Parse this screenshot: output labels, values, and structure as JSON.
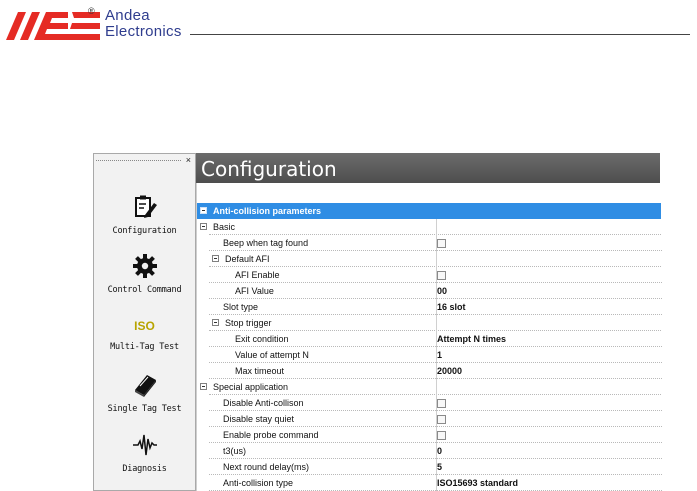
{
  "brand": {
    "line1": "Andea",
    "line2": "Electronics",
    "registered": "®",
    "colors": {
      "red": "#e52b24",
      "blue": "#2f3d8e"
    }
  },
  "sidebar": {
    "close_glyph": "×",
    "items": [
      {
        "label": "Configuration",
        "icon": "clipboard-pencil-icon"
      },
      {
        "label": "Control Command",
        "icon": "gear-icon"
      },
      {
        "label": "Multi-Tag Test",
        "icon": "iso-text-icon",
        "icon_text": "ISO"
      },
      {
        "label": "Single Tag Test",
        "icon": "book-icon"
      },
      {
        "label": "Diagnosis",
        "icon": "waveform-icon"
      }
    ]
  },
  "main": {
    "title": "Configuration",
    "grid": {
      "header": "Anti-collision parameters",
      "rows": [
        {
          "kind": "cat",
          "label": "Basic",
          "level": 0
        },
        {
          "kind": "leaf",
          "label": "Beep when tag found",
          "level": 1,
          "type": "checkbox",
          "checked": false
        },
        {
          "kind": "cat",
          "label": "Default AFI",
          "level": 1
        },
        {
          "kind": "leaf",
          "label": "AFI Enable",
          "level": 2,
          "type": "checkbox",
          "checked": false
        },
        {
          "kind": "leaf",
          "label": "AFI Value",
          "level": 2,
          "type": "text",
          "value": "00"
        },
        {
          "kind": "leaf",
          "label": "Slot type",
          "level": 1,
          "type": "text",
          "value": "16 slot"
        },
        {
          "kind": "cat",
          "label": "Stop trigger",
          "level": 1
        },
        {
          "kind": "leaf",
          "label": "Exit condition",
          "level": 2,
          "type": "text",
          "value": "Attempt N times"
        },
        {
          "kind": "leaf",
          "label": "Value of attempt N",
          "level": 2,
          "type": "text",
          "value": "1"
        },
        {
          "kind": "leaf",
          "label": "Max timeout",
          "level": 2,
          "type": "text",
          "value": "20000"
        },
        {
          "kind": "cat",
          "label": "Special application",
          "level": 0
        },
        {
          "kind": "leaf",
          "label": "Disable Anti-collison",
          "level": 1,
          "type": "checkbox",
          "checked": false
        },
        {
          "kind": "leaf",
          "label": "Disable stay quiet",
          "level": 1,
          "type": "checkbox",
          "checked": false
        },
        {
          "kind": "leaf",
          "label": "Enable probe command",
          "level": 1,
          "type": "checkbox",
          "checked": false
        },
        {
          "kind": "leaf",
          "label": "t3(us)",
          "level": 1,
          "type": "text",
          "value": "0"
        },
        {
          "kind": "leaf",
          "label": "Next round delay(ms)",
          "level": 1,
          "type": "text",
          "value": "5"
        },
        {
          "kind": "leaf",
          "label": "Anti-collision type",
          "level": 1,
          "type": "text",
          "value": "ISO15693 standard"
        }
      ]
    },
    "colors": {
      "titlebar": "#5a5a5a",
      "selection": "#2f8de4"
    }
  }
}
